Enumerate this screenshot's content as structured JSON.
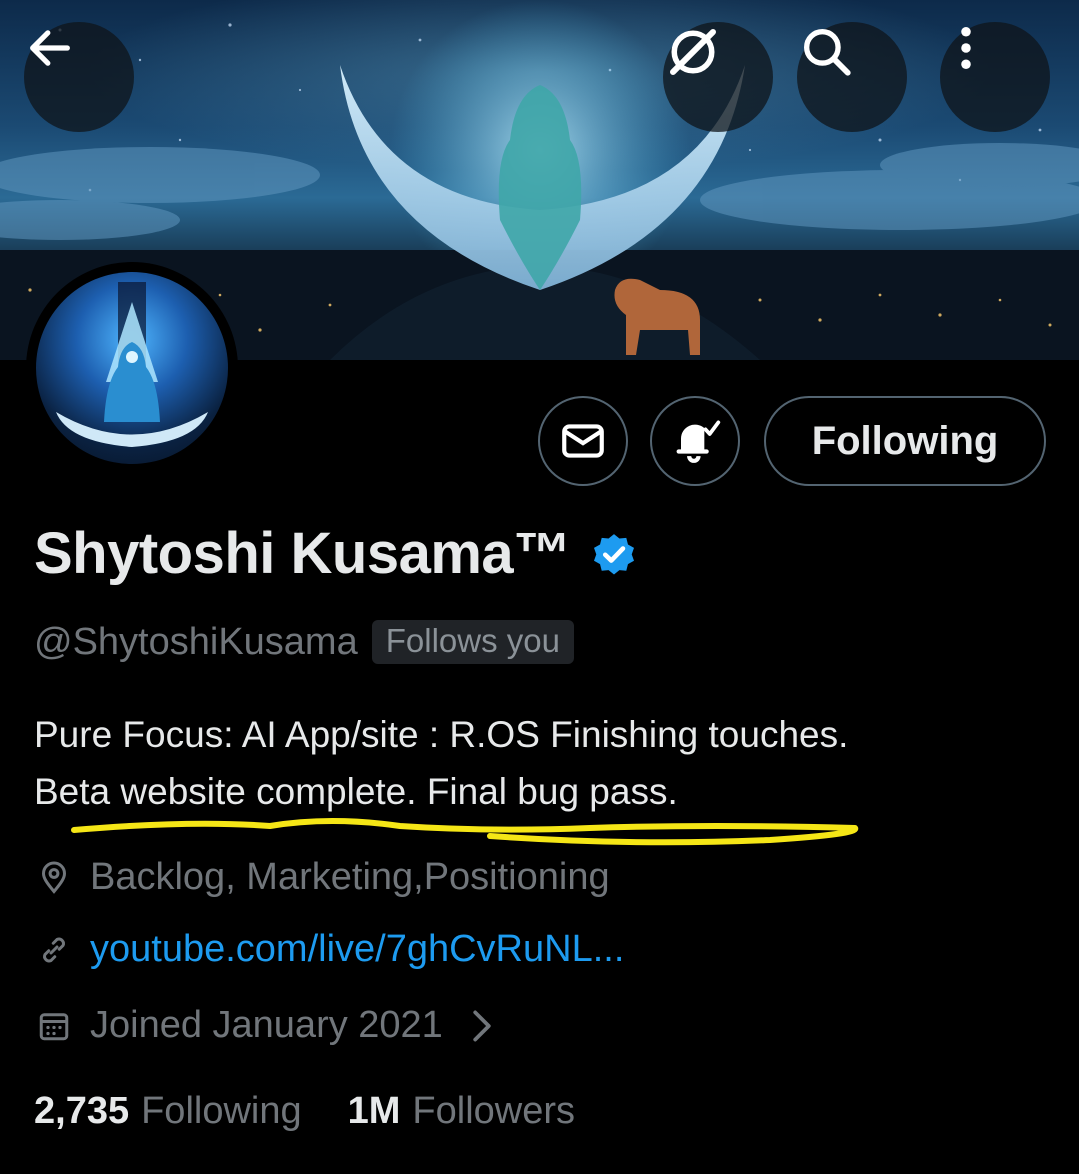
{
  "banner": {
    "description_icon": "moon-boat-night-city-banner"
  },
  "header": {
    "back_icon": "arrow-left-icon",
    "grok_icon": "grok-icon",
    "search_icon": "search-icon",
    "more_icon": "more-vertical-icon"
  },
  "profile": {
    "display_name": "Shytoshi Kusama™",
    "verified": true,
    "handle": "@ShytoshiKusama",
    "follows_you": "Follows you",
    "bio_lines": [
      "Pure Focus: AI App/site : R.OS Finishing touches.",
      "Beta website complete. Final bug pass."
    ],
    "location": "Backlog, Marketing,Positioning",
    "url": "youtube.com/live/7ghCvRuNL...",
    "joined": "Joined January 2021"
  },
  "actions": {
    "message_icon": "mail-icon",
    "notification_icon": "bell-check-icon",
    "follow_label": "Following"
  },
  "stats": {
    "following_count": "2,735",
    "following_label": "Following",
    "followers_count": "1M",
    "followers_label": "Followers"
  },
  "colors": {
    "background": "#000000",
    "primary_text": "#e7e9ea",
    "secondary_text": "#71767b",
    "link": "#1d9bf0",
    "verified": "#1d9bf0",
    "annotation_underline": "#f5e616"
  }
}
